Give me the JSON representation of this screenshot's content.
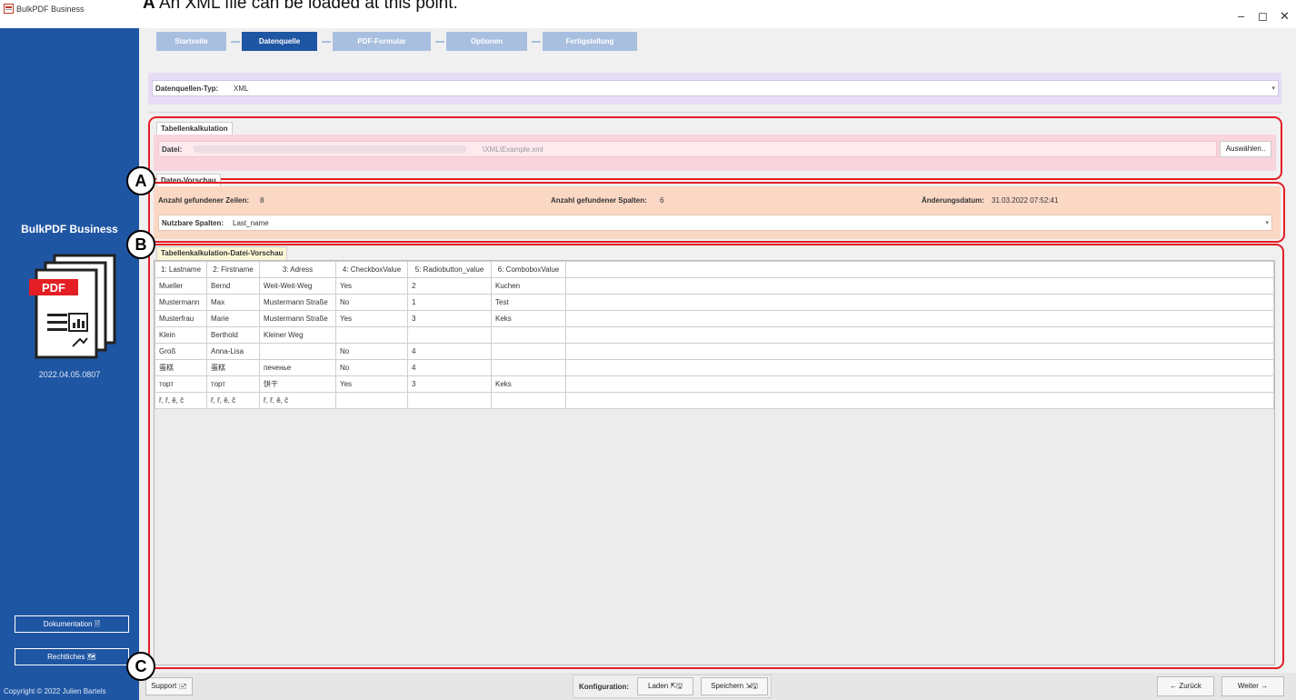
{
  "window": {
    "title": "BulkPDF Business",
    "minimize": "–",
    "maximize": "◻",
    "close": "✕"
  },
  "caption": {
    "letter": "A",
    "text": " An XML file can be loaded at this point."
  },
  "sidebar": {
    "brand": "BulkPDF Business",
    "version": "2022.04.05.0807",
    "doc_button": "Dokumentation 🗎",
    "legal_button": "Rechtliches 🗺",
    "copyright": "Copyright © 2022 Julien Bartels",
    "logo_text": "PDF"
  },
  "steps": [
    "Startseite",
    "Datenquelle",
    "PDF-Formular",
    "Optionen",
    "Fertigstellung"
  ],
  "datasource_type": {
    "label": "Datenquellen-Typ:",
    "value": "XML"
  },
  "spreadsheet": {
    "title": "Tabellenkalkulation",
    "file_label": "Datei:",
    "file_value": "\\XML\\Example.xml",
    "choose_button": "Auswählen.."
  },
  "data_preview": {
    "title": "Daten-Vorschau",
    "rows_label": "Anzahl gefundener Zeilen:",
    "rows_value": "8",
    "cols_label": "Anzahl gefundener Spalten:",
    "cols_value": "6",
    "date_label": "Änderungsdatum:",
    "date_value": "31.03.2022 07:52:41",
    "usable_label": "Nutzbare Spalten:",
    "usable_value": "Last_name"
  },
  "file_preview": {
    "title": "Tabellenkalkulation-Datei-Vorschau",
    "columns": [
      "1: Lastname",
      "2: Firstname",
      "3: Adress",
      "4: CheckboxValue",
      "5: Radiobutton_value",
      "6: ComboboxValue"
    ],
    "rows": [
      [
        "Mueller",
        "Bernd",
        "Weit-Weit-Weg",
        "Yes",
        "2",
        "Kuchen"
      ],
      [
        "Mustermann",
        "Max",
        "Mustermann Straße",
        "No",
        "1",
        "Test"
      ],
      [
        "Musterfrau",
        "Marie",
        "Mustermann Straße",
        "Yes",
        "3",
        "Keks"
      ],
      [
        "Klein",
        "Berthold",
        "Kleiner Weg",
        "",
        "",
        ""
      ],
      [
        "Groß",
        "Anna-Lisa",
        "",
        "No",
        "4",
        ""
      ],
      [
        "蛋糕",
        "蛋糕",
        "печенье",
        "No",
        "4",
        ""
      ],
      [
        "торт",
        "торт",
        "饼干",
        "Yes",
        "3",
        "Keks"
      ],
      [
        "ř, ř, ě, č",
        "ř, ř, ě, č",
        "ř, ř, ě, č",
        "",
        "",
        ""
      ]
    ]
  },
  "bottom": {
    "support": "Support 🖃",
    "config_label": "Konfiguration:",
    "load": "Laden ⇱🖫",
    "save": "Speichern ⇲🖫",
    "back": "← Zurück",
    "next": "Weiter →"
  },
  "markers": [
    "A",
    "B",
    "C"
  ],
  "colors": {
    "sidebar": "#1f56a3",
    "step_active": "#1f56a3",
    "step_inactive": "#a9bfe0",
    "highlight_box": "#e31e24",
    "spreadsheet_bg": "#f9d4dc",
    "preview_bg": "#fbd8c4",
    "datasource_bg": "#e7dcf6"
  }
}
